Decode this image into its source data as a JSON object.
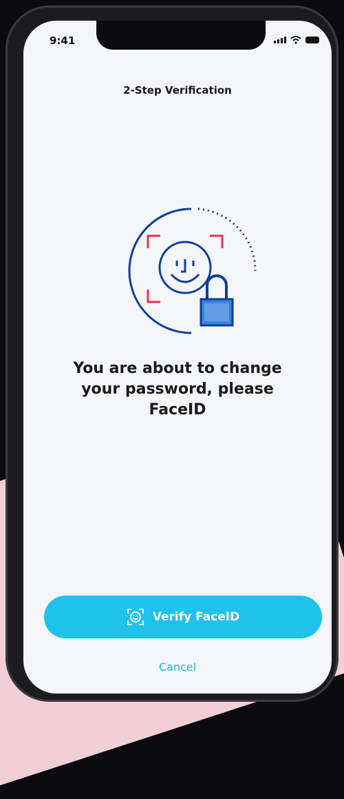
{
  "status_bar": {
    "time": "9:41",
    "signal_icon": "signal-icon",
    "wifi_icon": "wifi-icon",
    "battery_icon": "battery-icon"
  },
  "header": {
    "title": "2-Step Verification"
  },
  "illustration": {
    "icon": "face-id-lock-icon",
    "colors": {
      "primary": "#0a3f9c",
      "accent": "#e6344d",
      "lock": "#3b82d8"
    }
  },
  "message": "You are about to change your password, please FaceID",
  "actions": {
    "verify_label": "Verify FaceID",
    "verify_icon": "face-scan-icon",
    "cancel_label": "Cancel"
  },
  "colors": {
    "button": "#1fc2ea",
    "link": "#1fb6e0",
    "background": "#f5f6f9"
  }
}
